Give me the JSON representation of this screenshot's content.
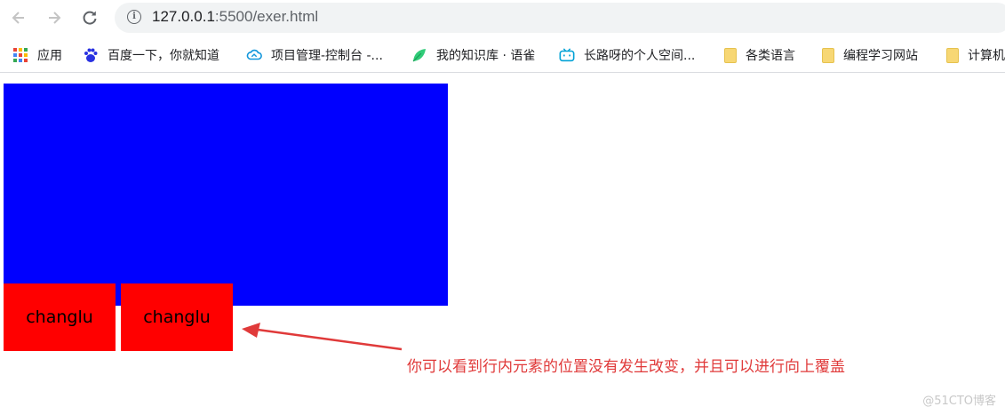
{
  "browser": {
    "back_icon": "arrow-left-icon",
    "forward_icon": "arrow-right-icon",
    "reload_icon": "reload-icon",
    "url_host": "127.0.0.1",
    "url_rest": ":5500/exer.html",
    "bookmarks": [
      {
        "label": "应用",
        "icon": "apps-grid-icon"
      },
      {
        "label": "百度一下，你就知道",
        "icon": "baidu-paw-icon"
      },
      {
        "label": "项目管理-控制台 -...",
        "icon": "cloud-icon"
      },
      {
        "label": "我的知识库 · 语雀",
        "icon": "yuque-leaf-icon"
      },
      {
        "label": "长路呀的个人空间...",
        "icon": "bilibili-tv-icon"
      },
      {
        "label": "各类语言",
        "icon": "folder-icon"
      },
      {
        "label": "编程学习网站",
        "icon": "folder-icon"
      },
      {
        "label": "计算机",
        "icon": "folder-icon"
      }
    ]
  },
  "page": {
    "span_texts": [
      "changlu",
      "changlu"
    ],
    "annotation": "你可以看到行内元素的位置没有发生改变，并且可以进行向上覆盖",
    "watermark": "@51CTO博客"
  },
  "colors": {
    "blue_box": "#0000ff",
    "red_span": "#ff0000",
    "annotation": "#e03a3a"
  }
}
